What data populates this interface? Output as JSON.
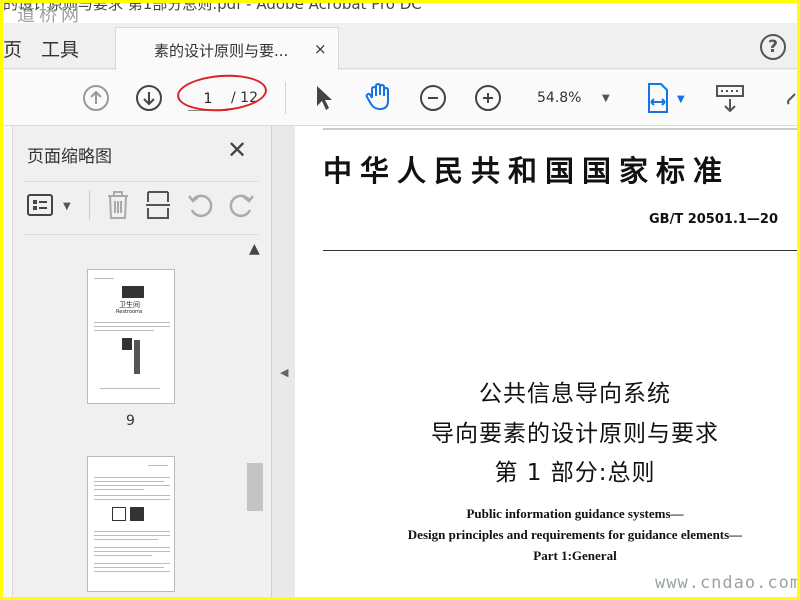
{
  "window": {
    "title": "的设计原则与要求 第1部分总则.pdf - Adobe Acrobat Pro DC",
    "watermark_top": "道桥网"
  },
  "tabs": {
    "home_label": "页",
    "tools_label": "工具",
    "doc_label": "素的设计原则与要...",
    "close_glyph": "×",
    "help_glyph": "?"
  },
  "toolbar": {
    "current_page": "1",
    "total_pages": "/ 12",
    "zoom": "54.8%"
  },
  "left_panel": {
    "title": "页面缩略图",
    "close_glyph": "✕",
    "thumbnails": [
      {
        "page_label": "9",
        "sign_text": "卫生间",
        "sign_sub": "Restrooms"
      },
      {
        "page_label": ""
      }
    ]
  },
  "document": {
    "heading": "中华人民共和国国家标准",
    "standard_no": "GB/T 20501.1—20",
    "cn_title_1": "公共信息导向系统",
    "cn_title_2": "导向要素的设计原则与要求",
    "cn_title_3": "第 1 部分:总则",
    "en_title_1": "Public information guidance systems—",
    "en_title_2": "Design principles and requirements for guidance elements—",
    "en_title_3": "Part 1:General",
    "watermark_bottom": "www.cndao.com"
  },
  "colors": {
    "annotation_oval": "#e02020",
    "accent_blue": "#1473e6",
    "page_bg": "#ffff00"
  }
}
